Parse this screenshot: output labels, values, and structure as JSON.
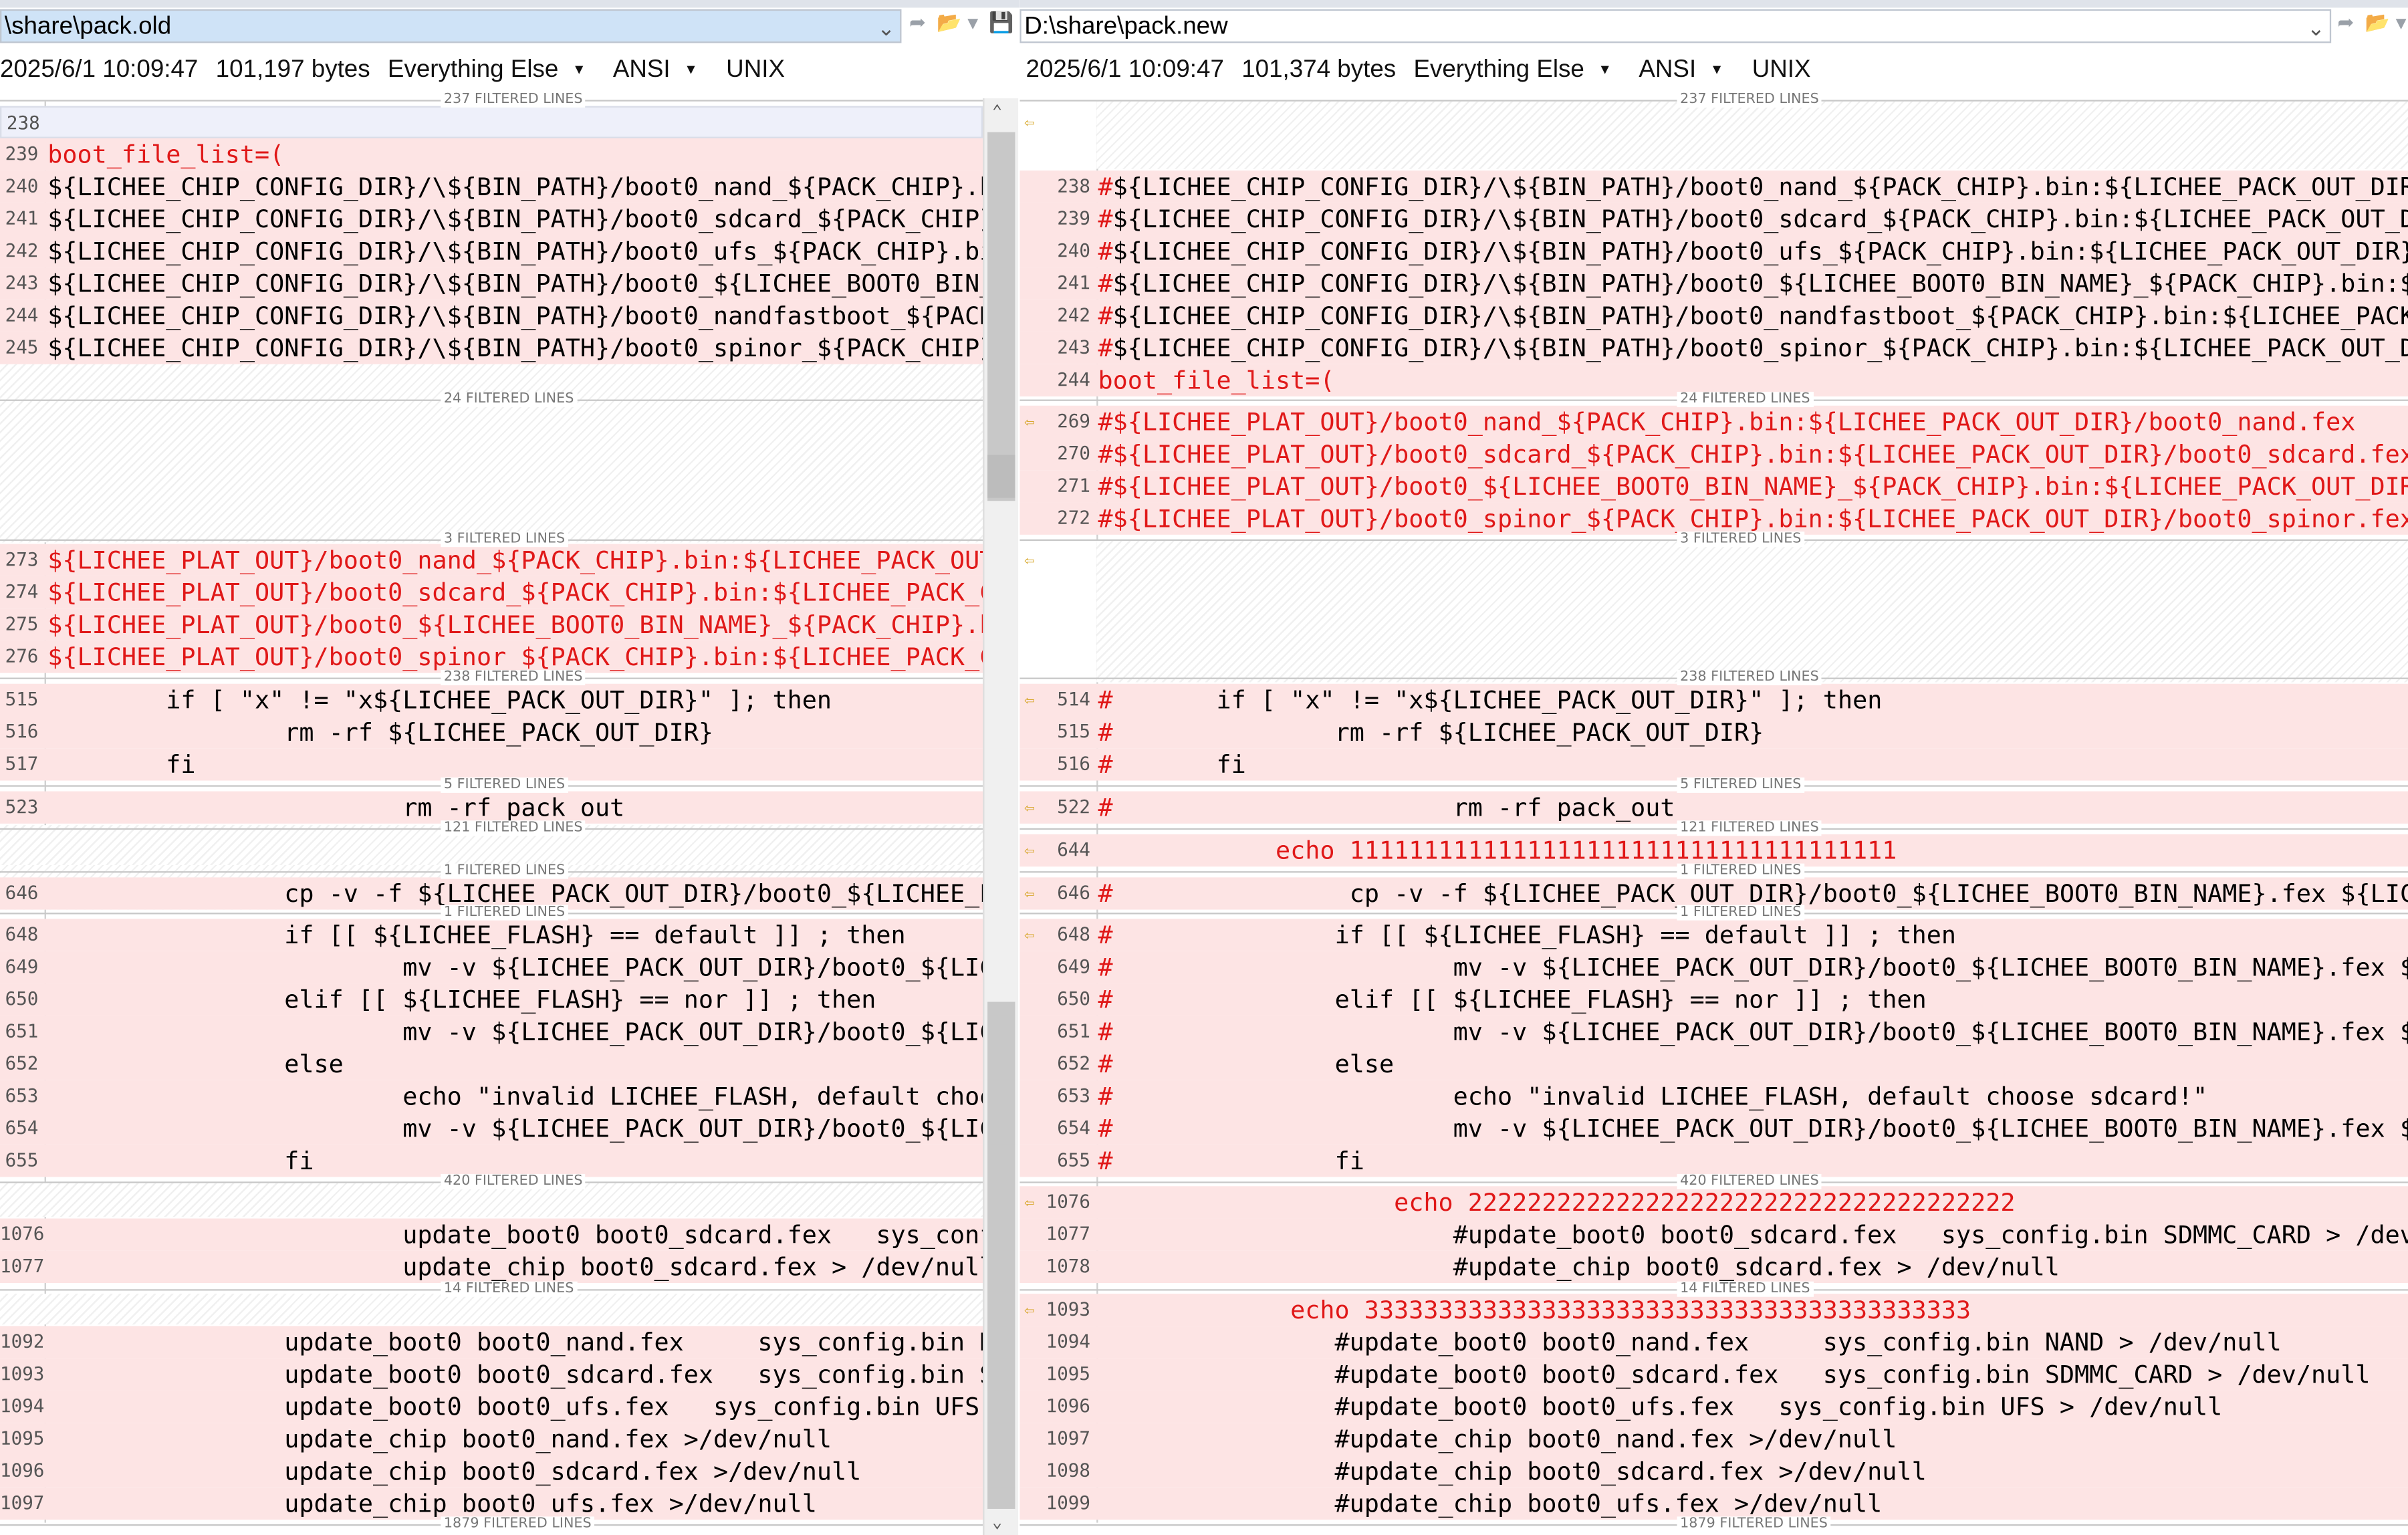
{
  "left": {
    "path": "\\share\\pack.old",
    "info": {
      "date": "2025/6/1 10:09:47",
      "size": "101,197 bytes",
      "filter": "Everything Else",
      "encoding": "ANSI",
      "eol": "UNIX"
    },
    "separators": [
      "237 FILTERED LINES",
      "24 FILTERED LINES",
      "3 FILTERED LINES",
      "238 FILTERED LINES",
      "5 FILTERED LINES",
      "121 FILTERED LINES",
      "1 FILTERED LINES",
      "1 FILTERED LINES",
      "420 FILTERED LINES",
      "14 FILTERED LINES",
      "1879 FILTERED LINES"
    ],
    "lines": [
      {
        "n": "238",
        "t": "",
        "k": "blankdiff"
      },
      {
        "n": "239",
        "t": "boot_file_list=(",
        "k": "red"
      },
      {
        "n": "240",
        "t": "${LICHEE_CHIP_CONFIG_DIR}/\\${BIN_PATH}/boot0_nand_${PACK_CHIP}.b",
        "k": "diff"
      },
      {
        "n": "241",
        "t": "${LICHEE_CHIP_CONFIG_DIR}/\\${BIN_PATH}/boot0_sdcard_${PACK_CHIP}",
        "k": "diff"
      },
      {
        "n": "242",
        "t": "${LICHEE_CHIP_CONFIG_DIR}/\\${BIN_PATH}/boot0_ufs_${PACK_CHIP}.bi",
        "k": "diff"
      },
      {
        "n": "243",
        "t": "${LICHEE_CHIP_CONFIG_DIR}/\\${BIN_PATH}/boot0_${LICHEE_BOOT0_BIN_",
        "k": "diff"
      },
      {
        "n": "244",
        "t": "${LICHEE_CHIP_CONFIG_DIR}/\\${BIN_PATH}/boot0_nandfastboot_${PACK",
        "k": "diff"
      },
      {
        "n": "245",
        "t": "${LICHEE_CHIP_CONFIG_DIR}/\\${BIN_PATH}/boot0_spinor_${PACK_CHIP}",
        "k": "diff"
      },
      {
        "n": "273",
        "t": "${LICHEE_PLAT_OUT}/boot0_nand_${PACK_CHIP}.bin:${LICHEE_PACK_OUT",
        "k": "red"
      },
      {
        "n": "274",
        "t": "${LICHEE_PLAT_OUT}/boot0_sdcard_${PACK_CHIP}.bin:${LICHEE_PACK_C",
        "k": "red"
      },
      {
        "n": "275",
        "t": "${LICHEE_PLAT_OUT}/boot0_${LICHEE_BOOT0_BIN_NAME}_${PACK_CHIP}.b",
        "k": "red"
      },
      {
        "n": "276",
        "t": "${LICHEE_PLAT_OUT}/boot0_spinor_${PACK_CHIP}.bin:${LICHEE_PACK_C",
        "k": "red"
      },
      {
        "n": "515",
        "t": "        if [ \"x\" != \"x${LICHEE_PACK_OUT_DIR}\" ]; then",
        "k": "diff"
      },
      {
        "n": "516",
        "t": "                rm -rf ${LICHEE_PACK_OUT_DIR}",
        "k": "diff"
      },
      {
        "n": "517",
        "t": "        fi",
        "k": "diff"
      },
      {
        "n": "523",
        "t": "                        rm -rf pack_out",
        "k": "diff"
      },
      {
        "n": "646",
        "t": "                cp -v -f ${LICHEE_PACK_OUT_DIR}/boot0_${LICHEE_E",
        "k": "diff"
      },
      {
        "n": "648",
        "t": "                if [[ ${LICHEE_FLASH} == default ]] ; then",
        "k": "diff"
      },
      {
        "n": "649",
        "t": "                        mv -v ${LICHEE_PACK_OUT_DIR}/boot0_${LIC",
        "k": "diff"
      },
      {
        "n": "650",
        "t": "                elif [[ ${LICHEE_FLASH} == nor ]] ; then",
        "k": "diff"
      },
      {
        "n": "651",
        "t": "                        mv -v ${LICHEE_PACK_OUT_DIR}/boot0_${LIC",
        "k": "diff"
      },
      {
        "n": "652",
        "t": "                else",
        "k": "diff"
      },
      {
        "n": "653",
        "t": "                        echo \"invalid LICHEE_FLASH, default choo",
        "k": "diff"
      },
      {
        "n": "654",
        "t": "                        mv -v ${LICHEE_PACK_OUT_DIR}/boot0_${LIC",
        "k": "diff"
      },
      {
        "n": "655",
        "t": "                fi",
        "k": "diff"
      },
      {
        "n": "1076",
        "t": "                        update_boot0 boot0_sdcard.fex   sys_conf",
        "k": "diff"
      },
      {
        "n": "1077",
        "t": "                        update_chip boot0_sdcard.fex > /dev/null",
        "k": "diff"
      },
      {
        "n": "1092",
        "t": "                update_boot0 boot0_nand.fex     sys_config.bin N",
        "k": "diff"
      },
      {
        "n": "1093",
        "t": "                update_boot0 boot0_sdcard.fex   sys_config.bin S",
        "k": "diff"
      },
      {
        "n": "1094",
        "t": "                update_boot0 boot0_ufs.fex   sys_config.bin UFS",
        "k": "diff"
      },
      {
        "n": "1095",
        "t": "                update_chip boot0_nand.fex >/dev/null",
        "k": "diff"
      },
      {
        "n": "1096",
        "t": "                update_chip boot0_sdcard.fex >/dev/null",
        "k": "diff"
      },
      {
        "n": "1097",
        "t": "                update_chip boot0_ufs.fex >/dev/null",
        "k": "diff"
      }
    ]
  },
  "right": {
    "path": "D:\\share\\pack.new",
    "info": {
      "date": "2025/6/1 10:09:47",
      "size": "101,374 bytes",
      "filter": "Everything Else",
      "encoding": "ANSI",
      "eol": "UNIX"
    },
    "separators": [
      "237 FILTERED LINES",
      "24 FILTERED LINES",
      "3 FILTERED LINES",
      "238 FILTERED LINES",
      "5 FILTERED LINES",
      "121 FILTERED LINES",
      "1 FILTERED LINES",
      "1 FILTERED LINES",
      "420 FILTERED LINES",
      "14 FILTERED LINES",
      "1879 FILTERED LINES"
    ],
    "lines": [
      {
        "n": "238",
        "t": "#${LICHEE_CHIP_CONFIG_DIR}/\\${BIN_PATH}/boot0_nand_${PACK_CHIP}.bin:${LICHEE_PACK_OUT_DIR",
        "k": "diffhash"
      },
      {
        "n": "239",
        "t": "#${LICHEE_CHIP_CONFIG_DIR}/\\${BIN_PATH}/boot0_sdcard_${PACK_CHIP}.bin:${LICHEE_PACK_OUT_D",
        "k": "diffhash"
      },
      {
        "n": "240",
        "t": "#${LICHEE_CHIP_CONFIG_DIR}/\\${BIN_PATH}/boot0_ufs_${PACK_CHIP}.bin:${LICHEE_PACK_OUT_DIR}",
        "k": "diffhash"
      },
      {
        "n": "241",
        "t": "#${LICHEE_CHIP_CONFIG_DIR}/\\${BIN_PATH}/boot0_${LICHEE_BOOT0_BIN_NAME}_${PACK_CHIP}.bin:$",
        "k": "diffhash"
      },
      {
        "n": "242",
        "t": "#${LICHEE_CHIP_CONFIG_DIR}/\\${BIN_PATH}/boot0_nandfastboot_${PACK_CHIP}.bin:${LICHEE_PACK",
        "k": "diffhash"
      },
      {
        "n": "243",
        "t": "#${LICHEE_CHIP_CONFIG_DIR}/\\${BIN_PATH}/boot0_spinor_${PACK_CHIP}.bin:${LICHEE_PACK_OUT_D",
        "k": "diffhash"
      },
      {
        "n": "244",
        "t": "boot_file_list=(",
        "k": "red"
      },
      {
        "n": "269",
        "t": "#${LICHEE_PLAT_OUT}/boot0_nand_${PACK_CHIP}.bin:${LICHEE_PACK_OUT_DIR}/boot0_nand.fex",
        "k": "red"
      },
      {
        "n": "270",
        "t": "#${LICHEE_PLAT_OUT}/boot0_sdcard_${PACK_CHIP}.bin:${LICHEE_PACK_OUT_DIR}/boot0_sdcard.fex",
        "k": "red"
      },
      {
        "n": "271",
        "t": "#${LICHEE_PLAT_OUT}/boot0_${LICHEE_BOOT0_BIN_NAME}_${PACK_CHIP}.bin:${LICHEE_PACK_OUT_DIR",
        "k": "red"
      },
      {
        "n": "272",
        "t": "#${LICHEE_PLAT_OUT}/boot0_spinor_${PACK_CHIP}.bin:${LICHEE_PACK_OUT_DIR}/boot0_spinor.fex",
        "k": "red"
      },
      {
        "n": "514",
        "t": "#       if [ \"x\" != \"x${LICHEE_PACK_OUT_DIR}\" ]; then",
        "k": "diffhash"
      },
      {
        "n": "515",
        "t": "#               rm -rf ${LICHEE_PACK_OUT_DIR}",
        "k": "diffhash"
      },
      {
        "n": "516",
        "t": "#       fi",
        "k": "diffhash"
      },
      {
        "n": "522",
        "t": "#                       rm -rf pack_out",
        "k": "diffhash"
      },
      {
        "n": "644",
        "t": "            echo 1111111111111111111111111111111111111",
        "k": "red"
      },
      {
        "n": "646",
        "t": "#                cp -v -f ${LICHEE_PACK_OUT_DIR}/boot0_${LICHEE_BOOT0_BIN_NAME}.fex ${LIC",
        "k": "diffhash"
      },
      {
        "n": "648",
        "t": "#               if [[ ${LICHEE_FLASH} == default ]] ; then",
        "k": "diffhash"
      },
      {
        "n": "649",
        "t": "#                       mv -v ${LICHEE_PACK_OUT_DIR}/boot0_${LICHEE_BOOT0_BIN_NAME}.fex $",
        "k": "diffhash"
      },
      {
        "n": "650",
        "t": "#               elif [[ ${LICHEE_FLASH} == nor ]] ; then",
        "k": "diffhash"
      },
      {
        "n": "651",
        "t": "#                       mv -v ${LICHEE_PACK_OUT_DIR}/boot0_${LICHEE_BOOT0_BIN_NAME}.fex $",
        "k": "diffhash"
      },
      {
        "n": "652",
        "t": "#               else",
        "k": "diffhash"
      },
      {
        "n": "653",
        "t": "#                       echo \"invalid LICHEE_FLASH, default choose sdcard!\"",
        "k": "diffhash"
      },
      {
        "n": "654",
        "t": "#                       mv -v ${LICHEE_PACK_OUT_DIR}/boot0_${LICHEE_BOOT0_BIN_NAME}.fex $",
        "k": "diffhash"
      },
      {
        "n": "655",
        "t": "#               fi",
        "k": "diffhash"
      },
      {
        "n": "1076",
        "t": "                    echo 2222222222222222222222222222222222222",
        "k": "red"
      },
      {
        "n": "1077",
        "t": "                        #update_boot0 boot0_sdcard.fex   sys_config.bin SDMMC_CARD > /dev",
        "k": "diff"
      },
      {
        "n": "1078",
        "t": "                        #update_chip boot0_sdcard.fex > /dev/null",
        "k": "diff"
      },
      {
        "n": "1093",
        "t": "             echo 33333333333333333333333333333333333333333",
        "k": "red"
      },
      {
        "n": "1094",
        "t": "                #update_boot0 boot0_nand.fex     sys_config.bin NAND > /dev/null",
        "k": "diff"
      },
      {
        "n": "1095",
        "t": "                #update_boot0 boot0_sdcard.fex   sys_config.bin SDMMC_CARD > /dev/null",
        "k": "diff"
      },
      {
        "n": "1096",
        "t": "                #update_boot0 boot0_ufs.fex   sys_config.bin UFS > /dev/null",
        "k": "diff"
      },
      {
        "n": "1097",
        "t": "                #update_chip boot0_nand.fex >/dev/null",
        "k": "diff"
      },
      {
        "n": "1098",
        "t": "                #update_chip boot0_sdcard.fex >/dev/null",
        "k": "diff"
      },
      {
        "n": "1099",
        "t": "                #update_chip boot0_ufs.fex >/dev/null",
        "k": "diff"
      }
    ]
  },
  "icons": {
    "dropdown": "chevron-down-icon",
    "back": "back-arrow-icon",
    "folder": "folder-icon",
    "save": "save-icon",
    "diff_marker": "left-arrow-marker-icon"
  }
}
